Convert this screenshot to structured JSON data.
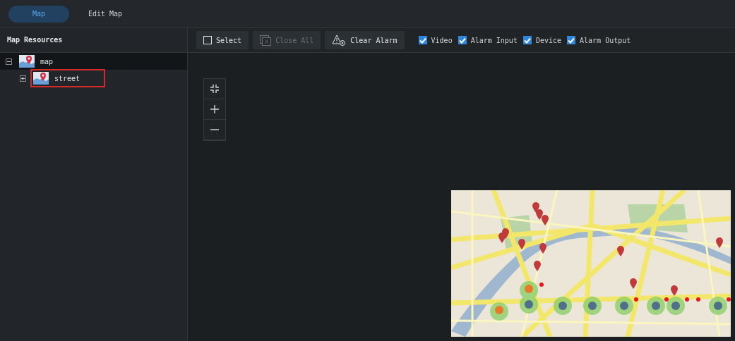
{
  "tabs": [
    {
      "label": "Map",
      "selected": true
    },
    {
      "label": "Edit Map",
      "selected": false
    }
  ],
  "sidebar": {
    "title": "Map Resources",
    "tree": [
      {
        "label": "map",
        "expanded": true,
        "selected": true,
        "outlined": false,
        "children": [
          {
            "label": "street",
            "expanded": false,
            "selected": false,
            "outlined": true
          }
        ]
      }
    ]
  },
  "toolbar": {
    "buttons": [
      {
        "label": "Select",
        "kind": "select",
        "disabled": false
      },
      {
        "label": "Close All",
        "kind": "close",
        "disabled": true
      },
      {
        "label": "Clear Alarm",
        "kind": "alarm",
        "disabled": false
      }
    ],
    "filters": [
      {
        "label": "Video",
        "checked": true
      },
      {
        "label": "Alarm Input",
        "checked": true
      },
      {
        "label": "Device",
        "checked": true
      },
      {
        "label": "Alarm Output",
        "checked": true
      }
    ]
  }
}
